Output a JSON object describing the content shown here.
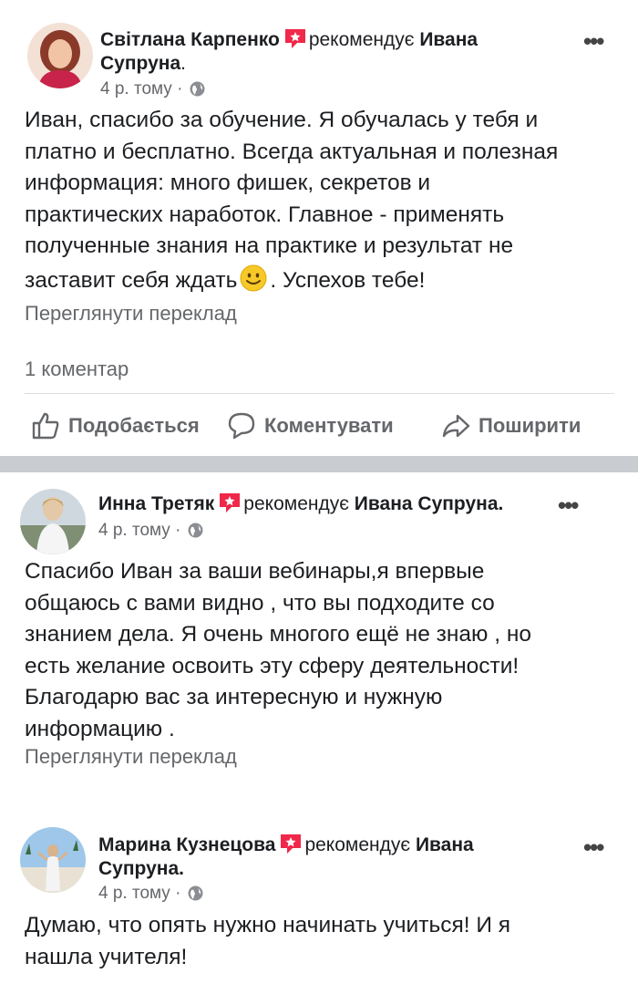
{
  "posts": [
    {
      "author": "Світлана Карпенко",
      "verb": "рекомендує",
      "target": "Ивана Супруна",
      "target_line1": "Ивана",
      "target_line2": "Супруна",
      "time": "4 р. тому",
      "text_lines": [
        "Иван, спасибо за обучение. Я обучалась у тебя и",
        "платно и бесплатно. Всегда актуальная и полезная",
        "информация: много фишек, секретов и",
        "практических наработок. Главное - применять",
        "полученные знания на практике и результат не",
        "заставит себя ждать",
        ". Успехов тебе!"
      ],
      "translate": "Переглянути переклад",
      "comments": "1 коментар",
      "actions": {
        "like": "Подобається",
        "comment": "Коментувати",
        "share": "Поширити"
      }
    },
    {
      "author": "Инна Третяк",
      "verb": "рекомендує",
      "target": "Ивана Супруна.",
      "time": "4 р. тому",
      "text_lines": [
        "Спасибо Иван за ваши вебинары,я впервые",
        "общаюсь с вами видно , что вы подходите со",
        "знанием дела. Я очень многого ещё не знаю , но",
        "есть желание освоить эту сферу деятельности!",
        "Благодарю вас за интересную и нужную",
        "информацию ."
      ],
      "translate": "Переглянути переклад"
    },
    {
      "author": "Марина Кузнецова",
      "verb": "рекомендує",
      "target_line1": "Ивана",
      "target_line2": "Супруна.",
      "time": "4 р. тому",
      "text_lines": [
        "Думаю, что опять нужно начинать учиться! И я",
        "нашла учителя!"
      ]
    }
  ],
  "more_glyph": "•••",
  "dot": "·",
  "colors": {
    "recommend_red": "#f02849",
    "muted": "#65676b",
    "separator": "#c9ccd1"
  }
}
